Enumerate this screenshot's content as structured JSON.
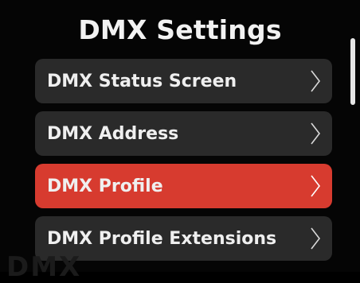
{
  "header": {
    "title": "DMX Settings"
  },
  "menu": {
    "items": [
      {
        "label": "DMX Status Screen",
        "selected": false
      },
      {
        "label": "DMX Address",
        "selected": false
      },
      {
        "label": "DMX Profile",
        "selected": true
      },
      {
        "label": "DMX Profile Extensions",
        "selected": false
      }
    ]
  },
  "background_text": "DMX",
  "colors": {
    "background": "#050505",
    "item_bg": "#2a2a2a",
    "selected_bg": "#d73b2f",
    "text": "#efefef"
  }
}
